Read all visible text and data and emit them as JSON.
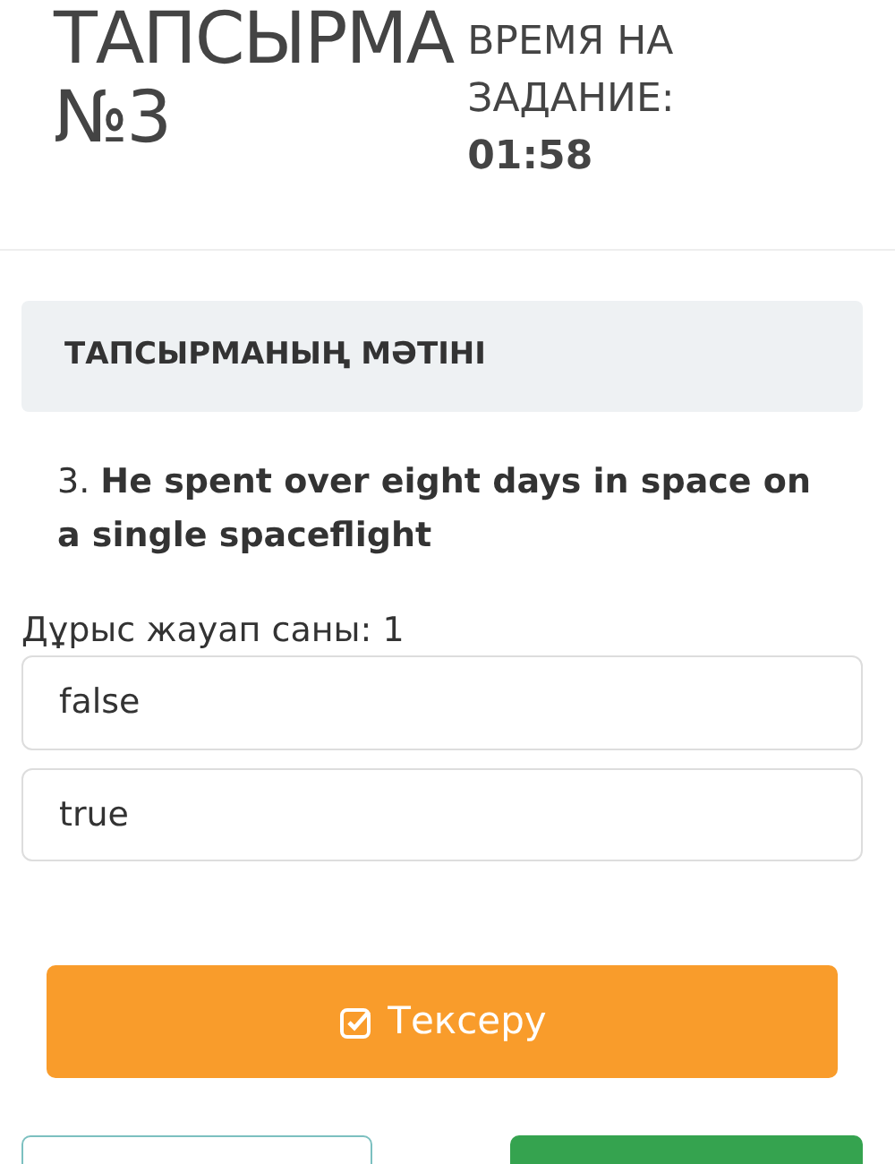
{
  "header": {
    "title": "ТАПСЫРМА",
    "number": "№3",
    "timer_label": "ВРЕМЯ НА ЗАДАНИЕ:",
    "timer": "01:58"
  },
  "task": {
    "heading": "ТАПСЫРМАНЫҢ МӘТІНІ",
    "question": "3. **He spent over eight days in space on a single spaceflight**"
  },
  "answer_count": "Дұрыс жауап саны: 1",
  "options": [
    {
      "label": "false",
      "selected": false
    },
    {
      "label": "true",
      "selected": false
    }
  ],
  "check_button": "Тексеру"
}
